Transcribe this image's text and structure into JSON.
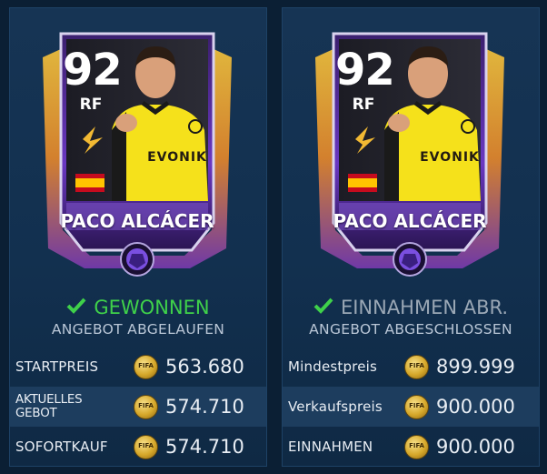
{
  "left_panel": {
    "card": {
      "rating": "92",
      "position": "RF",
      "name": "PACO ALCÁCER",
      "sponsor": "EVONIK"
    },
    "status": "GEWONNEN",
    "status_color": "#3fd14a",
    "subtitle": "ANGEBOT ABGELAUFEN",
    "rows": [
      {
        "label": "STARTPREIS",
        "value": "563.680"
      },
      {
        "label": "AKTUELLES GEBOT",
        "value": "574.710"
      },
      {
        "label": "SOFORTKAUF",
        "value": "574.710"
      }
    ]
  },
  "right_panel": {
    "card": {
      "rating": "92",
      "position": "RF",
      "name": "PACO ALCÁCER",
      "sponsor": "EVONIK"
    },
    "status": "EINNAHMEN ABR.",
    "status_color": "#9aa7b5",
    "subtitle": "ANGEBOT ABGESCHLOSSEN",
    "rows": [
      {
        "label": "Mindestpreis",
        "value": "899.999"
      },
      {
        "label": "Verkaufspreis",
        "value": "900.000"
      },
      {
        "label": "EINNAHMEN",
        "value": "900.000"
      }
    ]
  },
  "coin_text": "FIFA",
  "colors": {
    "card_purple": "#5b2ea8",
    "card_gold": "#f2b933",
    "panel_bg": "#133253",
    "jersey_yellow": "#f5e11b"
  },
  "icons": [
    "check-icon",
    "fifa-coin-icon",
    "ball-icon",
    "club-badge-icon",
    "spain-flag-icon"
  ]
}
